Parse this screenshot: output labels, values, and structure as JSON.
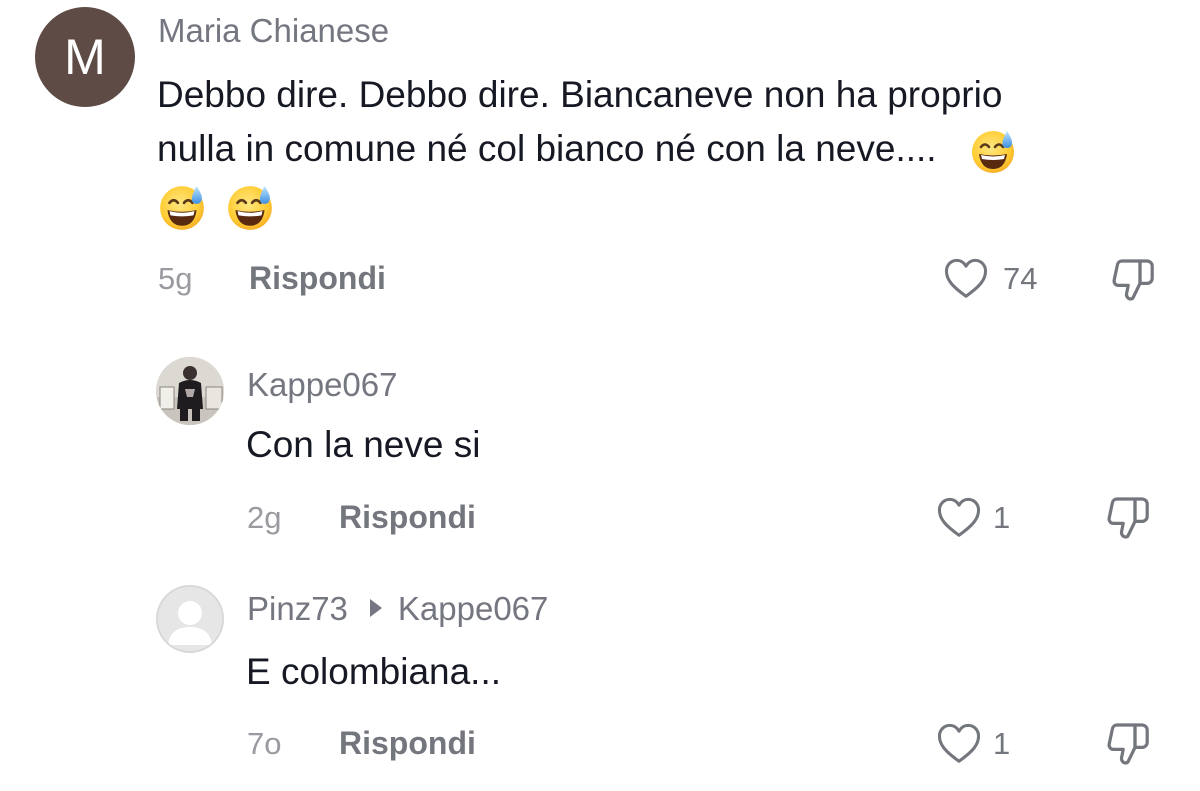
{
  "comments": [
    {
      "avatar_letter": "M",
      "username": "Maria Chianese",
      "text_line1": "Debbo dire. Debbo dire. Biancaneve non ha proprio",
      "text_line2": "nulla in comune né col bianco né con la neve....",
      "emoji": "grinning-face-with-sweat",
      "time": "5g",
      "reply_label": "Rispondi",
      "likes": "74"
    },
    {
      "username": "Kappe067",
      "text": "Con la neve si",
      "time": "2g",
      "reply_label": "Rispondi",
      "likes": "1"
    },
    {
      "username": "Pinz73",
      "reply_to": "Kappe067",
      "text": "E colombiana...",
      "time": "7o",
      "reply_label": "Rispondi",
      "likes": "1"
    }
  ],
  "icons": {
    "like": "heart-outline-icon",
    "dislike": "thumbs-down-icon",
    "reply_to": "caret-right-icon"
  },
  "colors": {
    "username": "#747680",
    "text": "#161823",
    "meta": "#9a9ba1",
    "avatar_m_bg": "#5e4b45"
  }
}
